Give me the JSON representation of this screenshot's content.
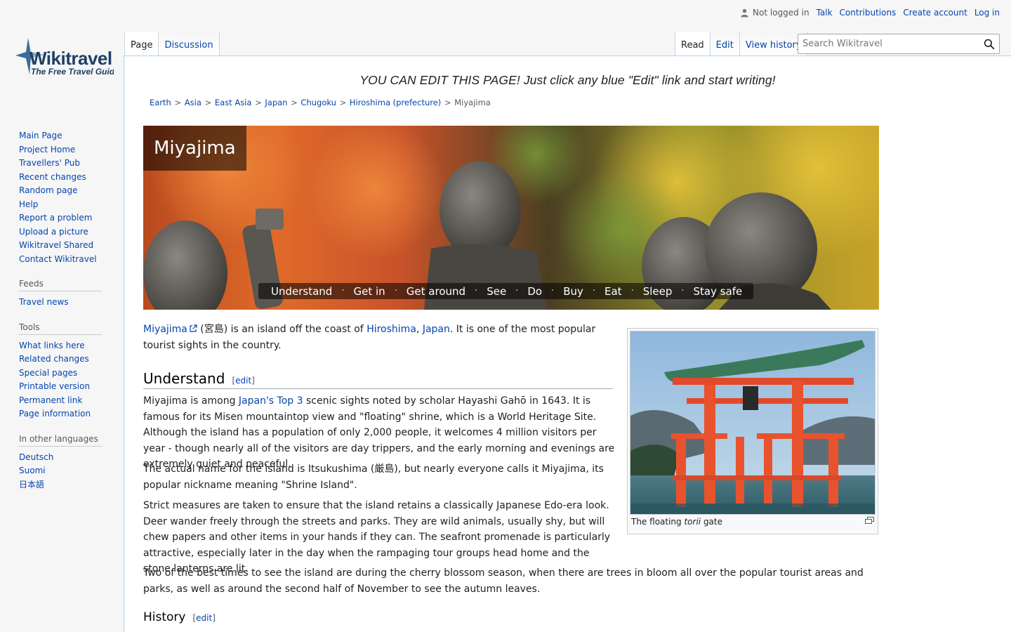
{
  "personal": {
    "not_logged_in": "Not logged in",
    "talk": "Talk",
    "contributions": "Contributions",
    "create_account": "Create account",
    "log_in": "Log in"
  },
  "logo": {
    "name": "Wikitravel",
    "tagline": "The Free Travel Guide"
  },
  "tabs": {
    "page": "Page",
    "discussion": "Discussion",
    "read": "Read",
    "edit": "Edit",
    "view_history": "View history"
  },
  "search": {
    "placeholder": "Search Wikitravel"
  },
  "sidebar": {
    "navigation": [
      "Main Page",
      "Project Home",
      "Travellers' Pub",
      "Recent changes",
      "Random page",
      "Help",
      "Report a problem",
      "Upload a picture",
      "Wikitravel Shared",
      "Contact Wikitravel"
    ],
    "feeds_heading": "Feeds",
    "feeds": [
      "Travel news"
    ],
    "tools_heading": "Tools",
    "tools": [
      "What links here",
      "Related changes",
      "Special pages",
      "Printable version",
      "Permanent link",
      "Page information"
    ],
    "languages_heading": "In other languages",
    "languages": [
      "Deutsch",
      "Suomi",
      "日本語"
    ]
  },
  "notice": "YOU CAN EDIT THIS PAGE! Just click any blue \"Edit\" link and start writing!",
  "breadcrumb": [
    "Earth",
    "Asia",
    "East Asia",
    "Japan",
    "Chugoku",
    "Hiroshima (prefecture)"
  ],
  "breadcrumb_current": "Miyajima",
  "breadcrumb_sep": ">",
  "banner": {
    "title": "Miyajima",
    "nav": [
      "Understand",
      "Get in",
      "Get around",
      "See",
      "Do",
      "Buy",
      "Eat",
      "Sleep",
      "Stay safe"
    ],
    "nav_sep": "·"
  },
  "intro": {
    "link_miyajima": "Miyajima",
    "kanji": " (宮島) is an island off the coast of ",
    "link_hiroshima": "Hiroshima",
    "comma": ", ",
    "link_japan": "Japan",
    "rest": ". It is one of the most popular tourist sights in the country."
  },
  "understand": {
    "heading": "Understand",
    "edit": "edit",
    "p1_a": "Miyajima is among ",
    "p1_link": "Japan's Top 3",
    "p1_b": " scenic sights noted by scholar Hayashi Gahō in 1643. It is famous for its Misen mountaintop view and \"floating\" shrine, which is a World Heritage Site. Although the island has a population of only 2,000 people, it welcomes 4 million visitors per year - though nearly all of the visitors are day trippers, and the early morning and evenings are extremely quiet and peaceful.",
    "p2": "The actual name for the island is Itsukushima (厳島), but nearly everyone calls it Miyajima, its popular nickname meaning \"Shrine Island\".",
    "p3": "Strict measures are taken to ensure that the island retains a classically Japanese Edo-era look. Deer wander freely through the streets and parks. They are wild animals, usually shy, but will chew papers and other items in your hands if they can. The seafront promenade is particularly attractive, especially later in the day when the rampaging tour groups head home and the stone lanterns are lit.",
    "p4": "Two of the best times to see the island are during the cherry blossom season, when there are trees in bloom all over the popular tourist areas and parks, as well as around the second half of November to see the autumn leaves."
  },
  "thumb": {
    "caption_a": "The floating ",
    "caption_em": "torii",
    "caption_b": " gate"
  },
  "history": {
    "heading": "History",
    "edit": "edit"
  }
}
